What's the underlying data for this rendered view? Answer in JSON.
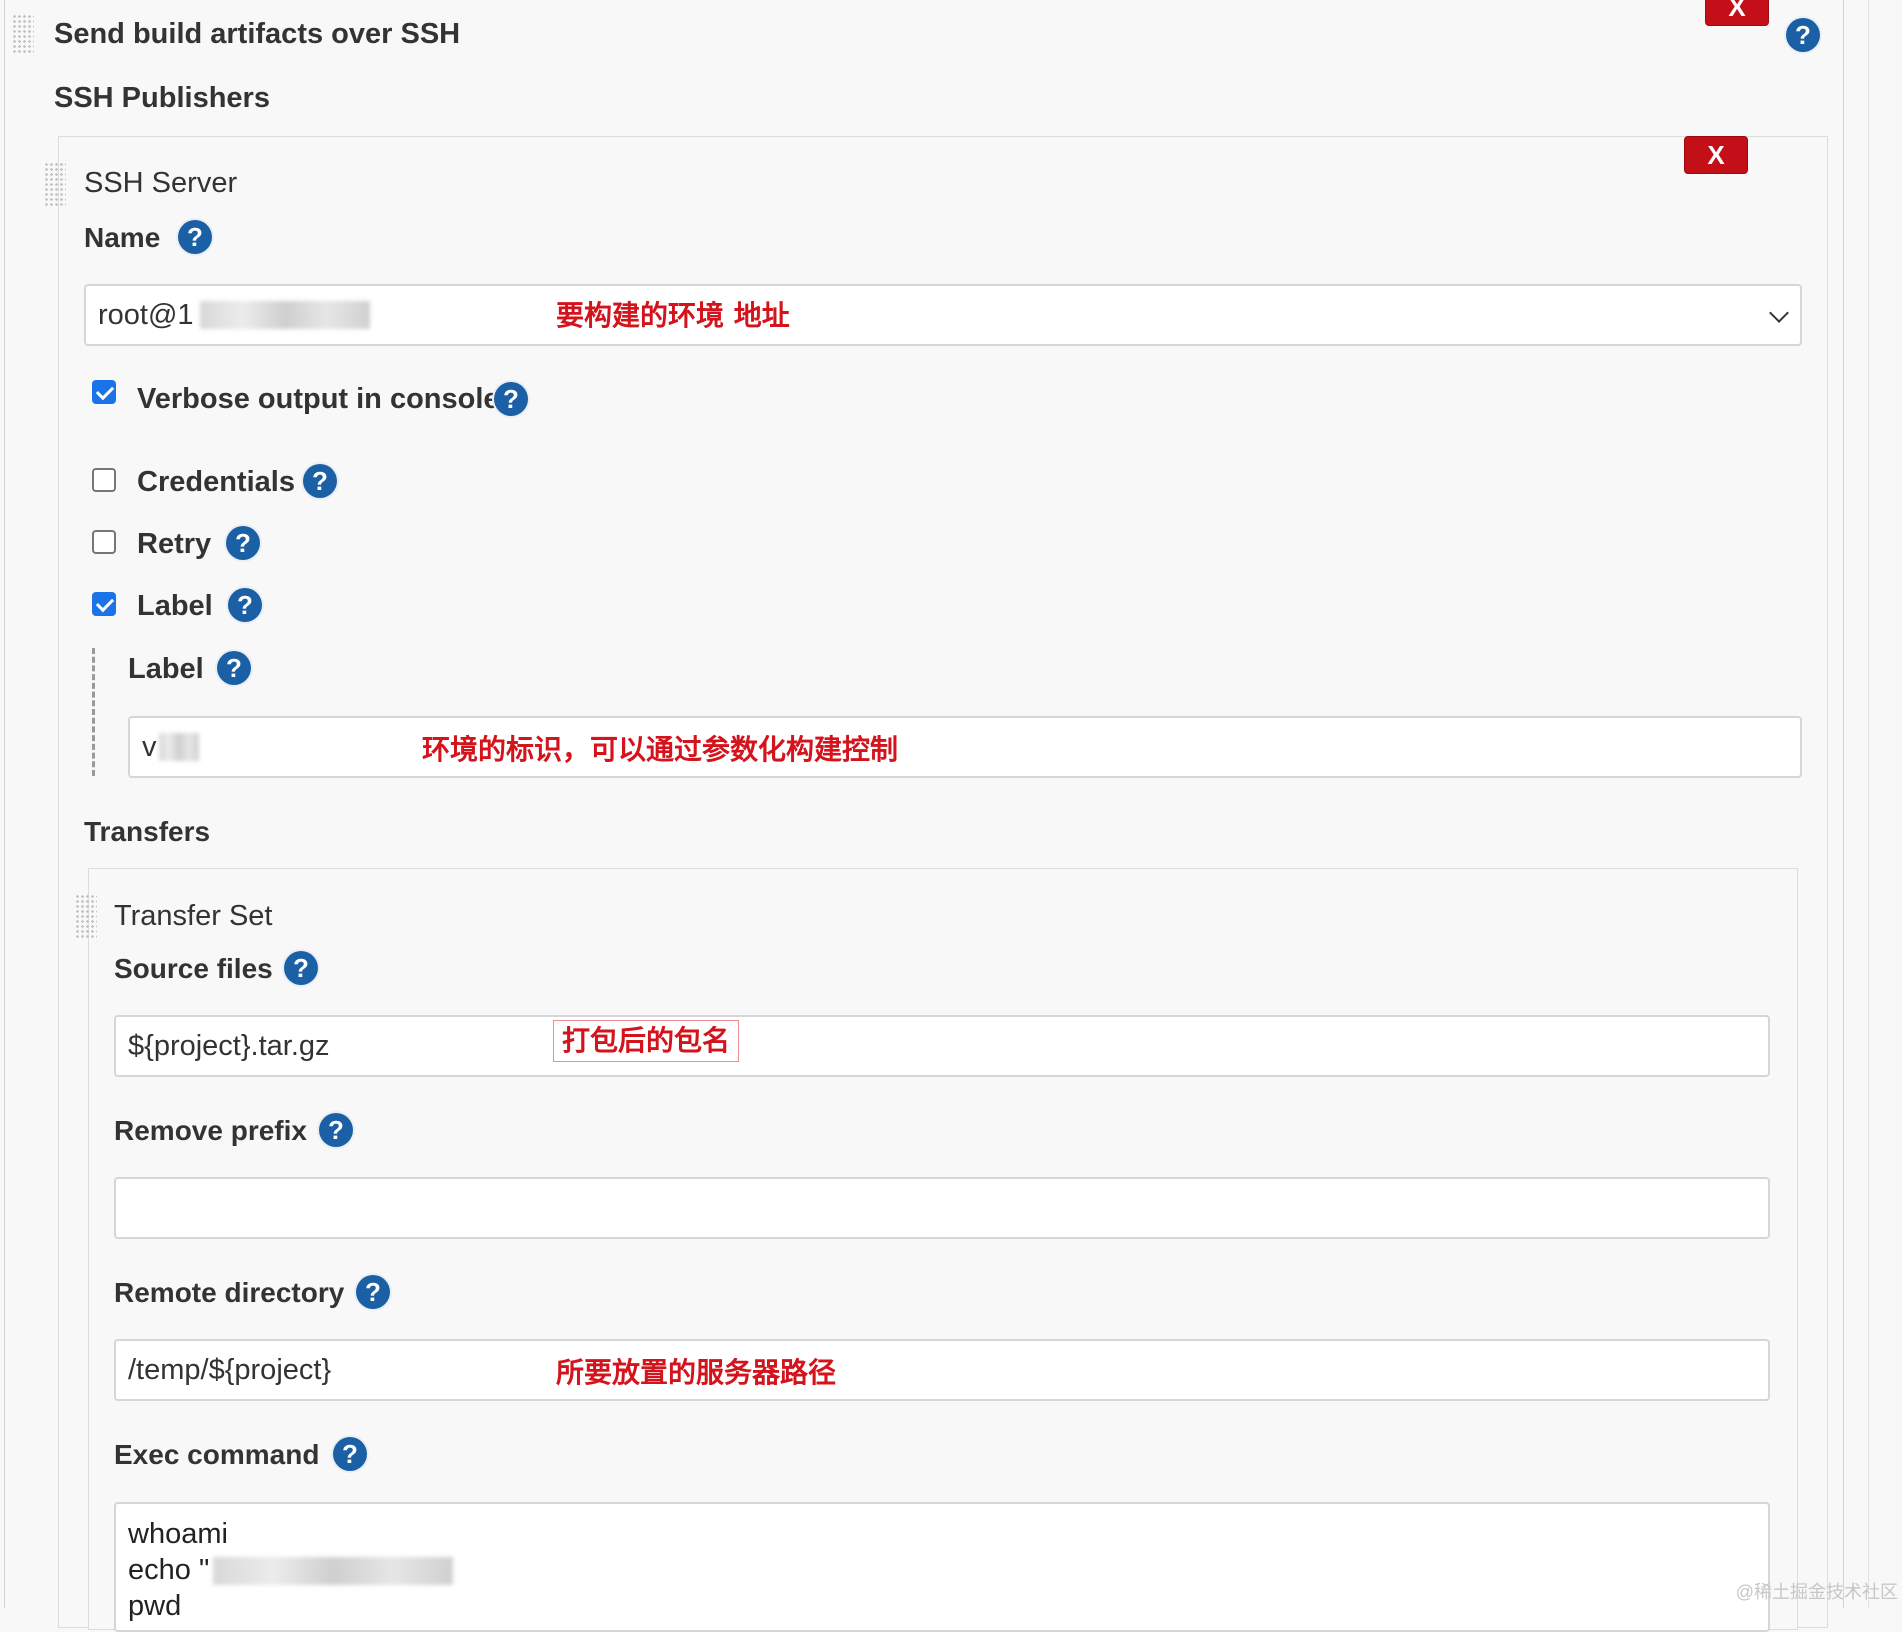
{
  "publisher": {
    "title": "Send build artifacts over SSH",
    "delete_label": "X",
    "help_label": "?"
  },
  "ssh_publishers": {
    "heading": "SSH Publishers",
    "server": {
      "heading": "SSH Server",
      "delete_label": "X",
      "name_label": "Name",
      "name_value": "root@1",
      "name_note": "要构建的环境 地址",
      "verbose_label": "Verbose output in console",
      "verbose_checked": true,
      "credentials_label": "Credentials",
      "credentials_checked": false,
      "retry_label": "Retry",
      "retry_checked": false,
      "label_checkbox_label": "Label",
      "label_checked": true,
      "label_field_label": "Label",
      "label_value": "v",
      "label_note": "环境的标识，可以通过参数化构建控制"
    }
  },
  "transfers": {
    "heading": "Transfers",
    "transfer_set_heading": "Transfer Set",
    "source_files_label": "Source files",
    "source_files_value": "${project}.tar.gz",
    "source_files_note": "打包后的包名",
    "remove_prefix_label": "Remove prefix",
    "remove_prefix_value": "",
    "remote_directory_label": "Remote directory",
    "remote_directory_value": "/temp/${project}",
    "remote_directory_note": "所要放置的服务器路径",
    "exec_command_label": "Exec command",
    "exec_command_lines": [
      "whoami",
      "echo \"",
      "pwd"
    ]
  },
  "watermark": "@稀土掘金技术社区",
  "colors": {
    "help_icon": "#1b5fa5",
    "delete_button": "#c40f19",
    "annotation": "#d4141d",
    "checkbox_checked": "#1a73e8"
  }
}
